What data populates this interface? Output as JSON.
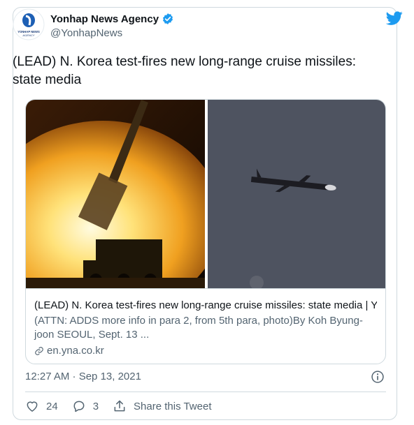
{
  "author": {
    "display_name": "Yonhap News Agency",
    "handle": "@YonhapNews",
    "avatar_text": "YONHAP NEWS AGENCY"
  },
  "tweet": {
    "text": "(LEAD) N. Korea test-fires new long-range cruise missiles: state media"
  },
  "link_card": {
    "title": "(LEAD) N. Korea test-fires new long-range cruise missiles: state media | Y...",
    "description": "(ATTN: ADDS more info in para 2, from 5th para, photo)By Koh Byung-joon SEOUL, Sept. 13 ...",
    "domain": "en.yna.co.kr"
  },
  "meta": {
    "timestamp": "12:27 AM · Sep 13, 2021"
  },
  "actions": {
    "likes": "24",
    "replies": "3",
    "share_label": "Share this Tweet"
  },
  "icons": {
    "verified": "verified-badge-icon",
    "bird": "twitter-bird-icon",
    "info": "info-icon",
    "like": "heart-icon",
    "reply": "reply-icon",
    "share": "share-icon",
    "link": "link-icon"
  },
  "colors": {
    "brand_blue": "#1d9bf0",
    "text_primary": "#0f1419",
    "text_secondary": "#536471",
    "border": "#cfd9de"
  }
}
